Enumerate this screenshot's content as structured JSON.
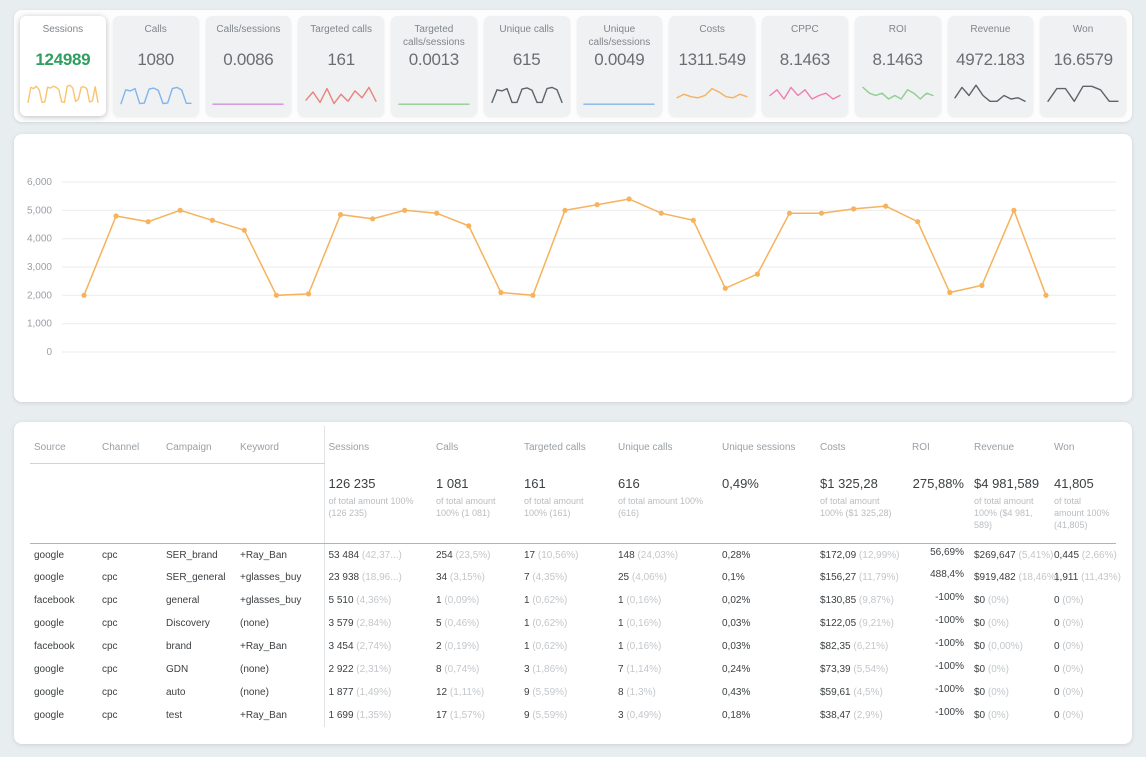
{
  "colors": {
    "page_bg": "#e8edf0",
    "panel_bg": "#ffffff",
    "card_bg": "#f0f1f2",
    "selected_value": "#2f9e5f",
    "value_text": "#6a6e72",
    "label_text": "#80868b",
    "chart_line": "#f6b25c",
    "grid_line": "#ebebeb",
    "tick_text": "#9aa0a6",
    "header_text": "#9aa0a6",
    "cell_text": "#3c4043",
    "pct_text": "#c3c7cb"
  },
  "metrics": {
    "cards": [
      {
        "id": "sessions",
        "label": "Sessions",
        "value": "124989",
        "selected": true,
        "color": "#f8c471",
        "spark": [
          2,
          8.5,
          8,
          9,
          7.5,
          2,
          2.2,
          8.6,
          8.2,
          9,
          8.6,
          7.6,
          2.3,
          2,
          9,
          9.5,
          8.2,
          2.4,
          3.4,
          8.6,
          8.8,
          8,
          2.2,
          2.6,
          8.8,
          2
        ]
      },
      {
        "id": "calls",
        "label": "Calls",
        "value": "1080",
        "selected": false,
        "color": "#82b4ec",
        "spark": [
          1.5,
          7.5,
          7,
          8,
          1.5,
          1.7,
          7.8,
          8.2,
          7.2,
          1.5,
          1.8,
          8,
          8.5,
          7.4,
          1.6,
          1.6
        ]
      },
      {
        "id": "calls-sessions",
        "label": "Calls/sessions",
        "value": "0.0086",
        "selected": false,
        "color": "#cf8fdb",
        "spark": [
          1.2,
          1.2,
          1.2,
          1.2,
          1.2,
          1.2,
          1.2,
          1.2
        ]
      },
      {
        "id": "targeted-calls",
        "label": "Targeted calls",
        "value": "161",
        "selected": false,
        "color": "#e8837a",
        "spark": [
          3,
          6.5,
          2,
          8,
          1.5,
          5.5,
          2.5,
          7,
          4,
          8.5,
          2.5
        ]
      },
      {
        "id": "targeted-calls-sessions",
        "label": "Targeted calls/sessions",
        "value": "0.0013",
        "selected": false,
        "color": "#8fce91",
        "spark": [
          1.2,
          1.2,
          1.2,
          1.2,
          1.2,
          1.2,
          1.2,
          1.2
        ]
      },
      {
        "id": "unique-calls",
        "label": "Unique calls",
        "value": "615",
        "selected": false,
        "color": "#5f6368",
        "spark": [
          2,
          7.5,
          7,
          8,
          2,
          2,
          7.8,
          8.3,
          7.3,
          2,
          2,
          8,
          8.5,
          7.5,
          2
        ]
      },
      {
        "id": "unique-calls-sessions",
        "label": "Unique calls/sessions",
        "value": "0.0049",
        "selected": false,
        "color": "#82b4ec",
        "spark": [
          1.2,
          1.2,
          1.2,
          1.2,
          1.2,
          1.2,
          1.2,
          1.2
        ]
      },
      {
        "id": "costs",
        "label": "Costs",
        "value": "1311.549",
        "selected": false,
        "color": "#f6b25c",
        "spark": [
          4,
          5.5,
          4.5,
          4,
          5,
          8,
          6.5,
          4.5,
          4,
          5.5,
          4.5
        ]
      },
      {
        "id": "cppc",
        "label": "CPPC",
        "value": "8.1463",
        "selected": false,
        "color": "#ef7fb1",
        "spark": [
          5,
          7.5,
          3.5,
          8.5,
          5,
          7.5,
          3.5,
          5,
          6,
          3.5,
          5
        ]
      },
      {
        "id": "roi",
        "label": "ROI",
        "value": "8.1463",
        "selected": false,
        "color": "#8fce91",
        "spark": [
          8.5,
          6,
          5,
          6,
          3.5,
          5,
          3.5,
          7.5,
          6,
          3.5,
          6,
          5
        ]
      },
      {
        "id": "revenue",
        "label": "Revenue",
        "value": "4972.183",
        "selected": false,
        "color": "#5f6368",
        "spark": [
          4,
          8.5,
          5,
          9.5,
          5,
          2.5,
          2.5,
          5,
          3.5,
          4,
          2.5
        ]
      },
      {
        "id": "won",
        "label": "Won",
        "value": "16.6579",
        "selected": false,
        "color": "#5f6368",
        "spark": [
          2.5,
          8,
          8,
          2.5,
          9,
          9,
          7.5,
          2.5,
          2.5
        ]
      }
    ]
  },
  "chart_data": {
    "type": "line",
    "title": "",
    "xlabel": "",
    "ylabel": "",
    "ylim": [
      0,
      6000
    ],
    "grid": true,
    "yticks": [
      {
        "value": 0,
        "label": "0"
      },
      {
        "value": 1000,
        "label": "1,000"
      },
      {
        "value": 2000,
        "label": "2,000"
      },
      {
        "value": 3000,
        "label": "3,000"
      },
      {
        "value": 4000,
        "label": "4,000"
      },
      {
        "value": 5000,
        "label": "5,000"
      },
      {
        "value": 6000,
        "label": "6,000"
      }
    ],
    "series": [
      {
        "name": "Sessions",
        "color": "#f6b25c",
        "values": [
          2000,
          4800,
          4600,
          5000,
          4650,
          4300,
          2000,
          2050,
          4850,
          4700,
          5000,
          4900,
          4450,
          2100,
          2000,
          5000,
          5200,
          5400,
          4900,
          4650,
          2250,
          2750,
          4900,
          4900,
          5050,
          5150,
          4600,
          2100,
          2350,
          5000,
          2000
        ]
      }
    ]
  },
  "table": {
    "columns": [
      {
        "id": "source",
        "label": "Source"
      },
      {
        "id": "channel",
        "label": "Channel"
      },
      {
        "id": "campaign",
        "label": "Campaign"
      },
      {
        "id": "keyword",
        "label": "Keyword"
      },
      {
        "id": "sessions",
        "label": "Sessions"
      },
      {
        "id": "calls",
        "label": "Calls"
      },
      {
        "id": "targeted_calls",
        "label": "Targeted calls"
      },
      {
        "id": "unique_calls",
        "label": "Unique calls"
      },
      {
        "id": "unique_sessions",
        "label": "Unique sessions"
      },
      {
        "id": "costs",
        "label": "Costs"
      },
      {
        "id": "roi",
        "label": "ROI"
      },
      {
        "id": "revenue",
        "label": "Revenue"
      },
      {
        "id": "won",
        "label": "Won"
      }
    ],
    "summary": {
      "sessions": {
        "value": "126 235",
        "sub": "of total amount 100% (126 235)"
      },
      "calls": {
        "value": "1 081",
        "sub": "of total amount 100% (1 081)"
      },
      "targeted_calls": {
        "value": "161",
        "sub": "of total amount 100% (161)"
      },
      "unique_calls": {
        "value": "616",
        "sub": "of total amount 100% (616)"
      },
      "unique_sessions": {
        "value": "0,49%"
      },
      "costs": {
        "value": "$1 325,28",
        "sub": "of total amount 100% ($1 325,28)"
      },
      "roi": {
        "value": "275,88%"
      },
      "revenue": {
        "value": "$4 981,589",
        "sub": "of total amount 100% ($4 981, 589)"
      },
      "won": {
        "value": "41,805",
        "sub": "of total amount 100% (41,805)"
      }
    },
    "rows": [
      {
        "source": "google",
        "channel": "cpc",
        "campaign": "SER_brand",
        "keyword": "+Ray_Ban",
        "sessions": {
          "value": "53 484",
          "pct": "(42,37...)"
        },
        "calls": {
          "value": "254",
          "pct": "(23,5%)"
        },
        "targeted_calls": {
          "value": "17",
          "pct": "(10,56%)"
        },
        "unique_calls": {
          "value": "148",
          "pct": "(24,03%)"
        },
        "unique_sessions": "0,28%",
        "costs": {
          "value": "$172,09",
          "pct": "(12,99%)"
        },
        "roi": "56,69%",
        "revenue": {
          "value": "$269,647",
          "pct": "(5,41%)"
        },
        "won": {
          "value": "0,445",
          "pct": "(2,66%)"
        }
      },
      {
        "source": "google",
        "channel": "cpc",
        "campaign": "SER_general",
        "keyword": "+glasses_buy",
        "sessions": {
          "value": "23 938",
          "pct": "(18,96...)"
        },
        "calls": {
          "value": "34",
          "pct": "(3,15%)"
        },
        "targeted_calls": {
          "value": "7",
          "pct": "(4,35%)"
        },
        "unique_calls": {
          "value": "25",
          "pct": "(4,06%)"
        },
        "unique_sessions": "0,1%",
        "costs": {
          "value": "$156,27",
          "pct": "(11,79%)"
        },
        "roi": "488,4%",
        "revenue": {
          "value": "$919,482",
          "pct": "(18,46%)"
        },
        "won": {
          "value": "1,911",
          "pct": "(11,43%)"
        }
      },
      {
        "source": "facebook",
        "channel": "cpc",
        "campaign": "general",
        "keyword": "+glasses_buy",
        "sessions": {
          "value": "5 510",
          "pct": "(4,36%)"
        },
        "calls": {
          "value": "1",
          "pct": "(0,09%)"
        },
        "targeted_calls": {
          "value": "1",
          "pct": "(0,62%)"
        },
        "unique_calls": {
          "value": "1",
          "pct": "(0,16%)"
        },
        "unique_sessions": "0,02%",
        "costs": {
          "value": "$130,85",
          "pct": "(9,87%)"
        },
        "roi": "-100%",
        "revenue": {
          "value": "$0",
          "pct": "(0%)"
        },
        "won": {
          "value": "0",
          "pct": "(0%)"
        }
      },
      {
        "source": "google",
        "channel": "cpc",
        "campaign": "Discovery",
        "keyword": "(none)",
        "sessions": {
          "value": "3 579",
          "pct": "(2,84%)"
        },
        "calls": {
          "value": "5",
          "pct": "(0,46%)"
        },
        "targeted_calls": {
          "value": "1",
          "pct": "(0,62%)"
        },
        "unique_calls": {
          "value": "1",
          "pct": "(0,16%)"
        },
        "unique_sessions": "0,03%",
        "costs": {
          "value": "$122,05",
          "pct": "(9,21%)"
        },
        "roi": "-100%",
        "revenue": {
          "value": "$0",
          "pct": "(0%)"
        },
        "won": {
          "value": "0",
          "pct": "(0%)"
        }
      },
      {
        "source": "facebook",
        "channel": "cpc",
        "campaign": "brand",
        "keyword": "+Ray_Ban",
        "sessions": {
          "value": "3 454",
          "pct": "(2,74%)"
        },
        "calls": {
          "value": "2",
          "pct": "(0,19%)"
        },
        "targeted_calls": {
          "value": "1",
          "pct": "(0,62%)"
        },
        "unique_calls": {
          "value": "1",
          "pct": "(0,16%)"
        },
        "unique_sessions": "0,03%",
        "costs": {
          "value": "$82,35",
          "pct": "(6,21%)"
        },
        "roi": "-100%",
        "revenue": {
          "value": "$0",
          "pct": "(0,00%)"
        },
        "won": {
          "value": "0",
          "pct": "(0%)"
        }
      },
      {
        "source": "google",
        "channel": "cpc",
        "campaign": "GDN",
        "keyword": "(none)",
        "sessions": {
          "value": "2 922",
          "pct": "(2,31%)"
        },
        "calls": {
          "value": "8",
          "pct": "(0,74%)"
        },
        "targeted_calls": {
          "value": "3",
          "pct": "(1,86%)"
        },
        "unique_calls": {
          "value": "7",
          "pct": "(1,14%)"
        },
        "unique_sessions": "0,24%",
        "costs": {
          "value": "$73,39",
          "pct": "(5,54%)"
        },
        "roi": "-100%",
        "revenue": {
          "value": "$0",
          "pct": "(0%)"
        },
        "won": {
          "value": "0",
          "pct": "(0%)"
        }
      },
      {
        "source": "google",
        "channel": "cpc",
        "campaign": "auto",
        "keyword": "(none)",
        "sessions": {
          "value": "1 877",
          "pct": "(1,49%)"
        },
        "calls": {
          "value": "12",
          "pct": "(1,11%)"
        },
        "targeted_calls": {
          "value": "9",
          "pct": "(5,59%)"
        },
        "unique_calls": {
          "value": "8",
          "pct": "(1,3%)"
        },
        "unique_sessions": "0,43%",
        "costs": {
          "value": "$59,61",
          "pct": "(4,5%)"
        },
        "roi": "-100%",
        "revenue": {
          "value": "$0",
          "pct": "(0%)"
        },
        "won": {
          "value": "0",
          "pct": "(0%)"
        }
      },
      {
        "source": "google",
        "channel": "cpc",
        "campaign": "test",
        "keyword": "+Ray_Ban",
        "sessions": {
          "value": "1 699",
          "pct": "(1,35%)"
        },
        "calls": {
          "value": "17",
          "pct": "(1,57%)"
        },
        "targeted_calls": {
          "value": "9",
          "pct": "(5,59%)"
        },
        "unique_calls": {
          "value": "3",
          "pct": "(0,49%)"
        },
        "unique_sessions": "0,18%",
        "costs": {
          "value": "$38,47",
          "pct": "(2,9%)"
        },
        "roi": "-100%",
        "revenue": {
          "value": "$0",
          "pct": "(0%)"
        },
        "won": {
          "value": "0",
          "pct": "(0%)"
        }
      }
    ]
  }
}
